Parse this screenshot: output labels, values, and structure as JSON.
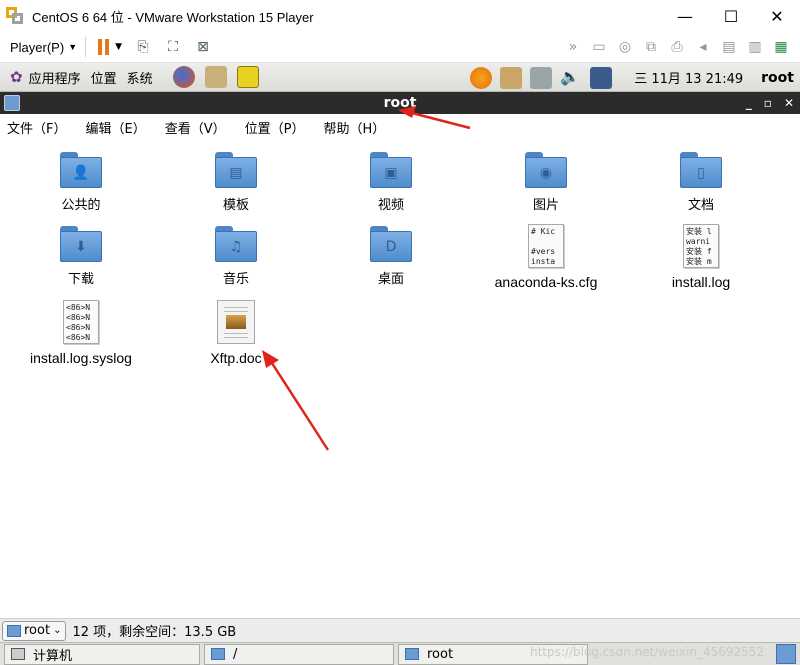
{
  "vm": {
    "title": "CentOS 6 64 位 - VMware Workstation 15 Player",
    "player_menu": "Player(P)",
    "icons": [
      "pause-icon",
      "send-keys-icon",
      "fullscreen-icon",
      "unity-icon",
      "send-icon",
      "network-icon",
      "cd-icon",
      "usb-icon",
      "printer-icon",
      "sound-icon",
      "hdd-icon",
      "library-icon",
      "message-icon"
    ]
  },
  "panel": {
    "menus": [
      "应用程序",
      "位置",
      "系统"
    ],
    "clock": "三 11月 13 21:49",
    "user": "root"
  },
  "nautilus": {
    "title": "root",
    "menus": [
      "文件（F）",
      "编辑（E）",
      "查看（V）",
      "位置（P）",
      "帮助（H）"
    ]
  },
  "files": [
    {
      "name": "公共的",
      "kind": "folder",
      "glyph": "👤"
    },
    {
      "name": "模板",
      "kind": "folder",
      "glyph": "▤"
    },
    {
      "name": "视频",
      "kind": "folder",
      "glyph": "▣"
    },
    {
      "name": "图片",
      "kind": "folder",
      "glyph": "◉"
    },
    {
      "name": "文档",
      "kind": "folder",
      "glyph": "▯"
    },
    {
      "name": "下载",
      "kind": "folder",
      "glyph": "⬇"
    },
    {
      "name": "音乐",
      "kind": "folder",
      "glyph": "♫"
    },
    {
      "name": "桌面",
      "kind": "folder",
      "glyph": "D"
    },
    {
      "name": "anaconda-ks.cfg",
      "kind": "text",
      "preview": [
        "# Kic",
        "",
        "#vers",
        "insta"
      ]
    },
    {
      "name": "install.log",
      "kind": "text",
      "preview": [
        "安装 l",
        "warni",
        "安装 f",
        "安装 m"
      ]
    },
    {
      "name": "install.log.syslog",
      "kind": "text",
      "preview": [
        "<86>N",
        "<86>N",
        "<86>N",
        "<86>N"
      ]
    },
    {
      "name": "Xftp.doc",
      "kind": "doc"
    }
  ],
  "status": {
    "location": "root",
    "info": "12 项，剩余空间：13.5 GB"
  },
  "taskbar": {
    "items": [
      "计算机",
      "/",
      "root"
    ],
    "watermark": "https://blog.csdn.net/weixin_45692552"
  }
}
